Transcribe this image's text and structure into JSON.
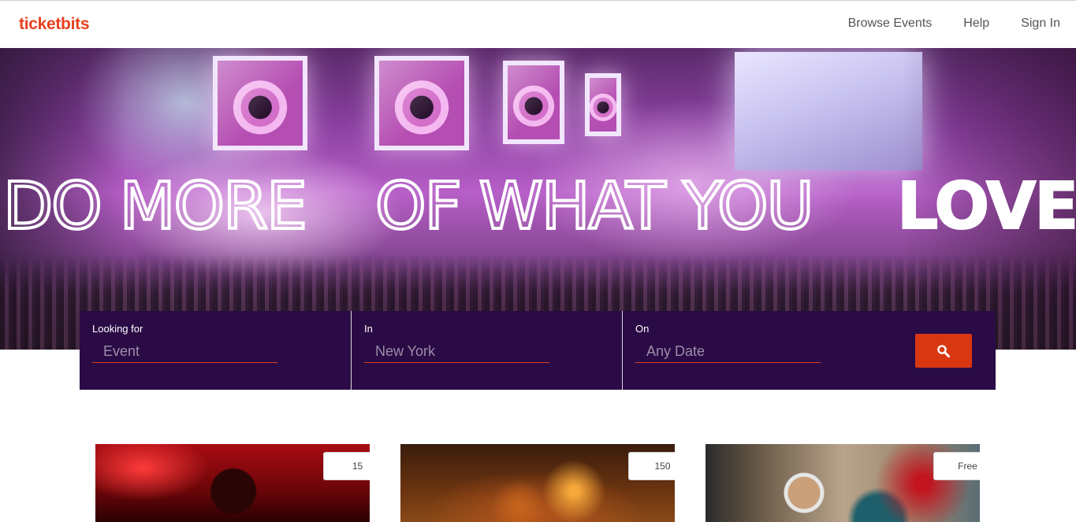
{
  "brand": {
    "name": "ticketbits",
    "color": "#e8401e"
  },
  "nav": {
    "items": [
      {
        "label": "Browse Events"
      },
      {
        "label": "Help"
      },
      {
        "label": "Sign In"
      }
    ]
  },
  "hero": {
    "headline_words": [
      "DO MORE",
      "OF WHAT YOU",
      "LOVE"
    ]
  },
  "search": {
    "fields": [
      {
        "label": "Looking for",
        "placeholder": "Event"
      },
      {
        "label": "In",
        "placeholder": "New York"
      },
      {
        "label": "On",
        "placeholder": "Any Date"
      }
    ],
    "button_icon": "search-icon",
    "bar_color": "#2b0b45",
    "button_color": "#d83712"
  },
  "cards": [
    {
      "badge": "15"
    },
    {
      "badge": "150"
    },
    {
      "badge": "Free"
    }
  ]
}
